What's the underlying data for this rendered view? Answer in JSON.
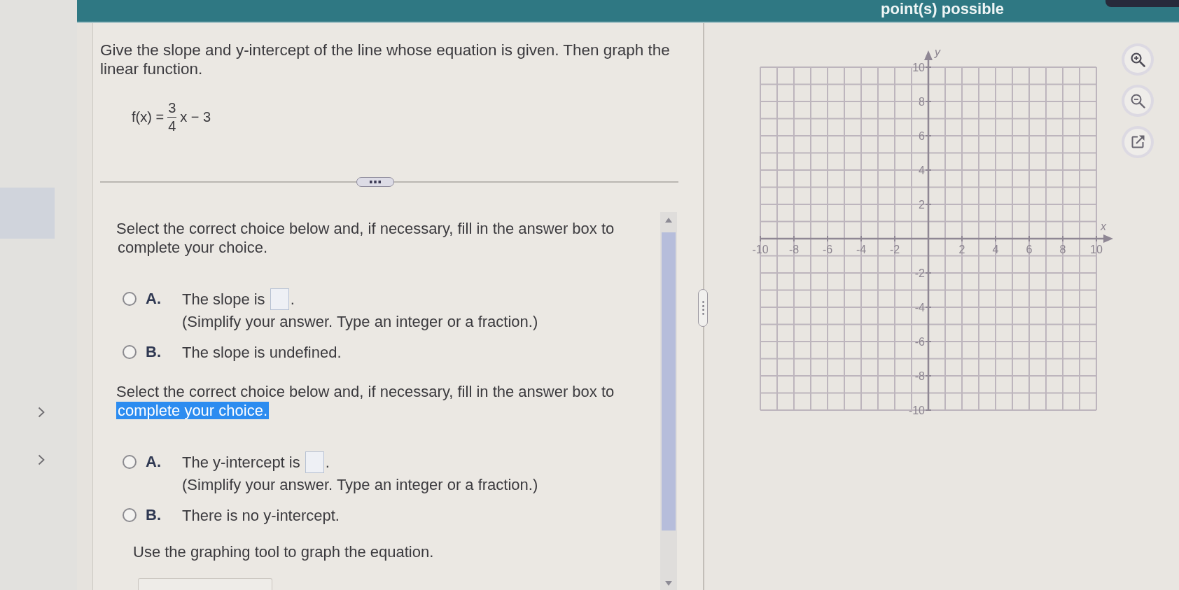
{
  "header": {
    "points_text": "point(s) possible"
  },
  "sidebar": {
    "items": [
      {
        "selected": true,
        "expandable": false
      },
      {
        "selected": false,
        "expandable": true
      },
      {
        "selected": false,
        "expandable": true
      }
    ]
  },
  "question": {
    "prompt": "Give the slope and y-intercept of the line whose equation is given. Then graph the linear function.",
    "equation": {
      "lhs": "f(x) =",
      "numerator": "3",
      "denominator": "4",
      "rhs": "x − 3"
    }
  },
  "parts": [
    {
      "instruction": {
        "lead": "Select the correct choice below and, if necessary, fill in the answer box to",
        "tail": "complete your choice.",
        "tail_selected": false
      },
      "choices": [
        {
          "kind": "answer",
          "letter": "A.",
          "text": "The slope is",
          "suffix": ".",
          "hint": "(Simplify your answer. Type an integer or a fraction.)",
          "selected": false
        },
        {
          "kind": "plain",
          "letter": "B.",
          "text": "The slope is undefined.",
          "selected": false
        }
      ]
    },
    {
      "instruction": {
        "lead": "Select the correct choice below and, if necessary, fill in the answer box to",
        "tail": "complete your choice.",
        "tail_selected": true
      },
      "choices": [
        {
          "kind": "answer",
          "letter": "A.",
          "text": "The y-intercept is",
          "suffix": ".",
          "hint": "(Simplify your answer. Type an integer or a fraction.)",
          "selected": false
        },
        {
          "kind": "plain",
          "letter": "B.",
          "text": "There is no y-intercept.",
          "selected": false
        }
      ]
    }
  ],
  "graph_instruction": "Use the graphing tool to graph the equation.",
  "graph": {
    "chart_data": {
      "type": "line",
      "xlabel": "x",
      "ylabel": "y",
      "xlim": [
        -10,
        10
      ],
      "ylim": [
        -10,
        10
      ],
      "xticks": [
        -10,
        -8,
        -6,
        -4,
        -2,
        2,
        4,
        6,
        8,
        10
      ],
      "yticks": [
        -10,
        -8,
        -6,
        -4,
        -2,
        2,
        4,
        6,
        8,
        10
      ],
      "grid": true
    }
  }
}
